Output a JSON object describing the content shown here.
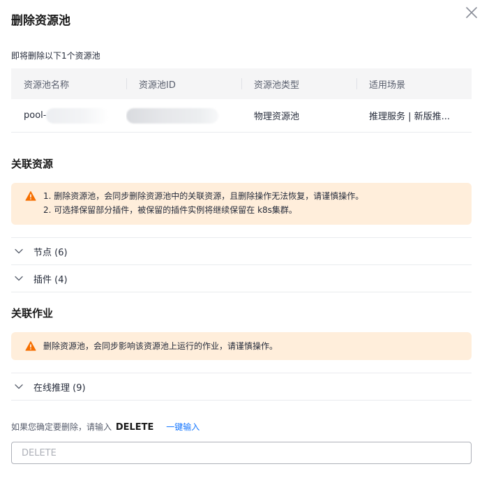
{
  "dialog": {
    "title": "删除资源池",
    "subtitle": "即将删除以下1个资源池"
  },
  "table": {
    "headers": [
      "资源池名称",
      "资源池ID",
      "资源池类型",
      "适用场景"
    ],
    "row": {
      "name_prefix": "pool-",
      "type": "物理资源池",
      "scenario": "推理服务 | 新版推..."
    }
  },
  "related_resources": {
    "title": "关联资源",
    "alert_lines": [
      "1. 删除资源池，会同步删除资源池中的关联资源，且删除操作无法恢复，请谨慎操作。",
      "2. 可选择保留部分插件，被保留的插件实例将继续保留在 k8s集群。"
    ],
    "items": [
      {
        "label": "节点 (6)"
      },
      {
        "label": "插件 (4)"
      }
    ]
  },
  "related_jobs": {
    "title": "关联作业",
    "alert_text": "删除资源池，会同步影响该资源池上运行的作业，请谨慎操作。",
    "items": [
      {
        "label": "在线推理 (9)"
      }
    ]
  },
  "confirm": {
    "prompt": "如果您确定要删除，请输入",
    "keyword": "DELETE",
    "one_click": "一键输入",
    "placeholder": "DELETE"
  },
  "colors": {
    "warning": "#f66f00",
    "alert_bg": "#ffeedb",
    "link": "#1476ff"
  },
  "icons": {
    "close": "close-icon",
    "warning": "warning-icon",
    "chevron": "chevron-down-icon"
  }
}
